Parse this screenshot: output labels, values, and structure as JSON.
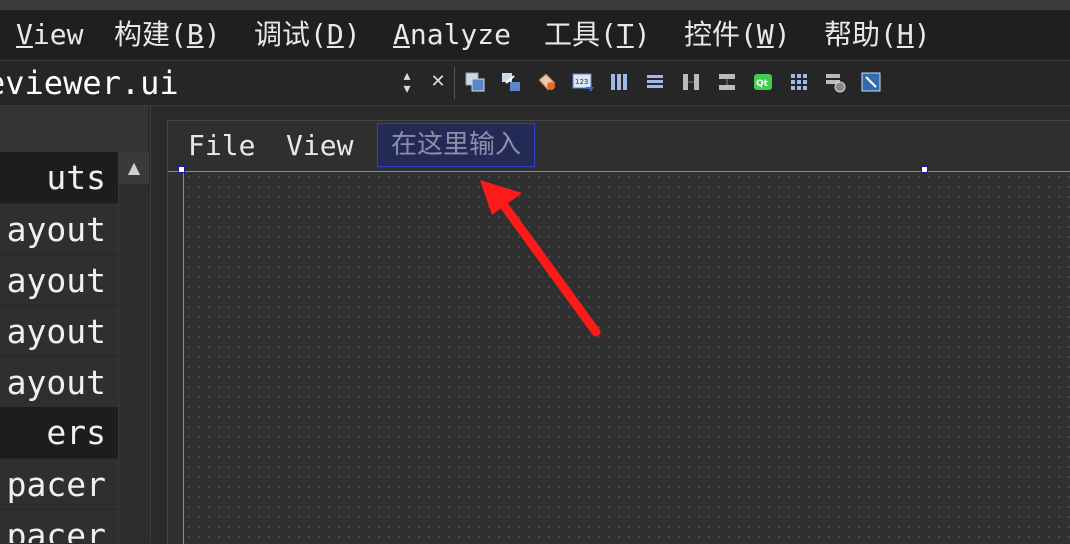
{
  "menubar": {
    "items": [
      {
        "label": "View",
        "mnemonic": "V",
        "rest": "iew"
      },
      {
        "label": "构建(B)",
        "prefix": "构建(",
        "mnemonic": "B",
        "suffix": ")"
      },
      {
        "label": "调试(D)",
        "prefix": "调试(",
        "mnemonic": "D",
        "suffix": ")"
      },
      {
        "label": "Analyze",
        "mnemonic": "A",
        "rest": "nalyze"
      },
      {
        "label": "工具(T)",
        "prefix": "工具(",
        "mnemonic": "T",
        "suffix": ")"
      },
      {
        "label": "控件(W)",
        "prefix": "控件(",
        "mnemonic": "W",
        "suffix": ")"
      },
      {
        "label": "帮助(H)",
        "prefix": "帮助(",
        "mnemonic": "H",
        "suffix": ")"
      }
    ]
  },
  "toolbar": {
    "file_name": "eviewer.ui",
    "combo_arrows": "⌃⌄",
    "close_glyph": "✕",
    "icons": [
      "edit-widgets-icon",
      "edit-signals-slots-icon",
      "edit-buddies-icon",
      "edit-tab-order-icon",
      "layout-horizontal-icon",
      "layout-vertical-icon",
      "layout-horizontal-splitter-icon",
      "layout-vertical-splitter-icon",
      "layout-form-icon",
      "layout-grid-icon",
      "break-layout-icon",
      "adjust-size-icon"
    ],
    "qt_icon_text": "Qt"
  },
  "widget_box": {
    "rows": [
      {
        "text": "uts",
        "kind": "category"
      },
      {
        "text": "ayout",
        "kind": "item"
      },
      {
        "text": "ayout",
        "kind": "item"
      },
      {
        "text": "ayout",
        "kind": "item"
      },
      {
        "text": "ayout",
        "kind": "item"
      },
      {
        "text": "ers",
        "kind": "category"
      },
      {
        "text": "pacer",
        "kind": "item"
      },
      {
        "text": "pacer",
        "kind": "item"
      }
    ],
    "scroll_up_glyph": "▲"
  },
  "form": {
    "menu_items": [
      "File",
      "View"
    ],
    "type_here_placeholder": "在这里输入"
  },
  "colors": {
    "arrow": "#ff1a1a",
    "type_here_bg": "#232a56",
    "type_here_border": "#2f40c8"
  }
}
